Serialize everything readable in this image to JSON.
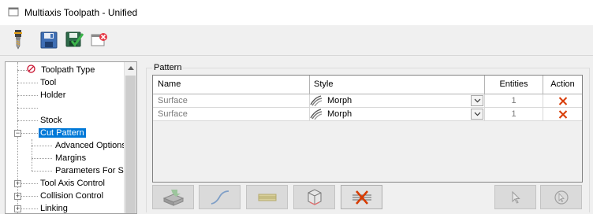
{
  "window": {
    "title": "Multiaxis Toolpath - Unified"
  },
  "toolbar": {
    "buttons": [
      {
        "icon": "tool-icon"
      },
      {
        "icon": "save-icon"
      },
      {
        "icon": "save-and-close-icon"
      },
      {
        "icon": "close-cancel-icon"
      }
    ]
  },
  "tree": {
    "items": [
      {
        "label": "Toolpath Type",
        "icon": "no-entry-icon"
      },
      {
        "label": "Tool"
      },
      {
        "label": "Holder"
      },
      {
        "label": ""
      },
      {
        "label": "Stock"
      },
      {
        "label": "Cut Pattern",
        "expander": "−",
        "selected": true
      },
      {
        "label": "Advanced Options"
      },
      {
        "label": "Margins"
      },
      {
        "label": "Parameters For Su"
      },
      {
        "label": "Tool Axis Control",
        "expander": "+"
      },
      {
        "label": "Collision Control",
        "expander": "+"
      },
      {
        "label": "Linking",
        "expander": "+"
      }
    ]
  },
  "pattern": {
    "group_label": "Pattern",
    "columns": {
      "name": "Name",
      "style": "Style",
      "entities": "Entities",
      "action": "Action"
    },
    "rows": [
      {
        "name": "Surface",
        "style": "Morph",
        "entities": "1",
        "action_icon": "delete-x-icon"
      },
      {
        "name": "Surface",
        "style": "Morph",
        "entities": "1",
        "action_icon": "delete-x-icon"
      }
    ]
  },
  "bottom_buttons": [
    {
      "icon": "select-surface-icon"
    },
    {
      "icon": "select-curve-icon"
    },
    {
      "icon": "select-lines-icon"
    },
    {
      "icon": "select-box-icon"
    },
    {
      "icon": "delete-all-icon"
    },
    {
      "icon": "select-pointer-icon"
    },
    {
      "icon": "reselect-icon"
    }
  ],
  "colors": {
    "selection": "#0078d7",
    "delete_red": "#d83b01",
    "panel_bg": "#f0f0f0"
  }
}
